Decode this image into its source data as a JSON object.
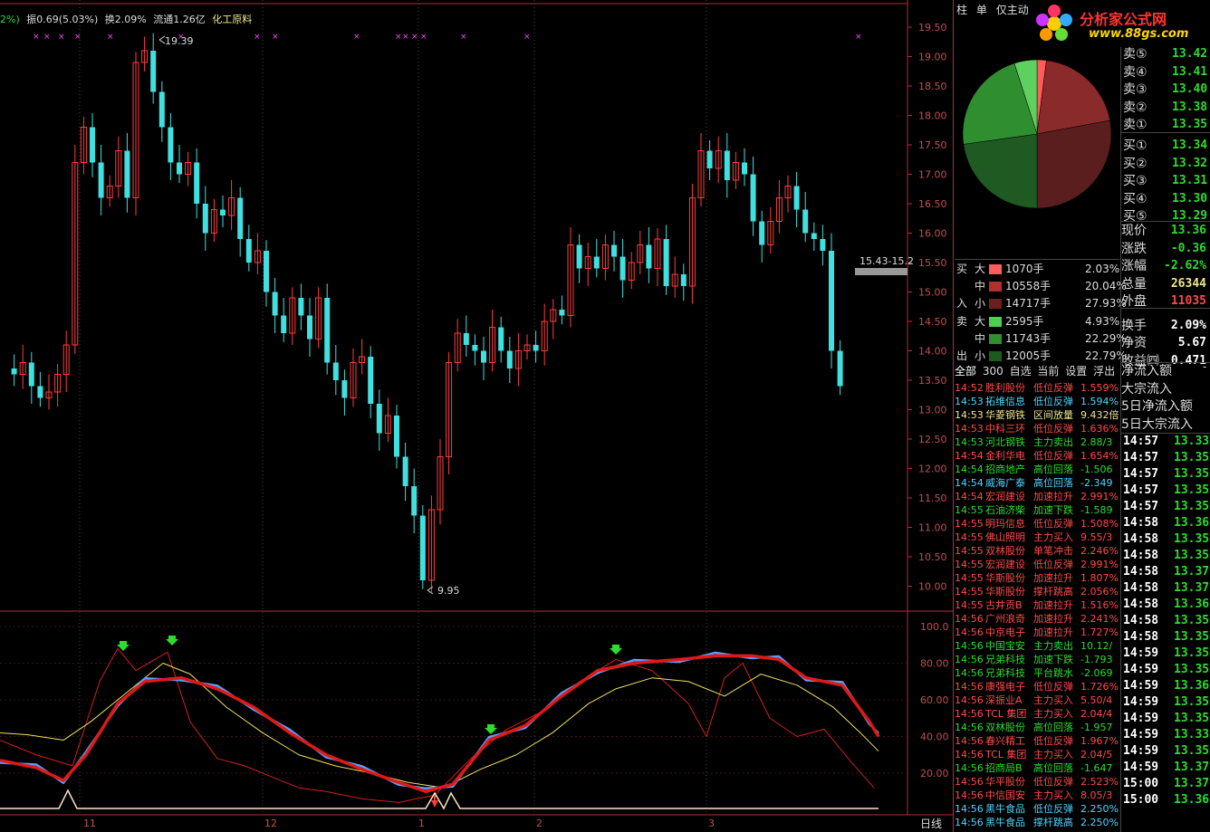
{
  "info_bar": {
    "pct": "2%)",
    "amplitude": "振0.69(5.03%)",
    "turnover": "换2.09%",
    "float": "流通1.26亿",
    "industry": "化工原料"
  },
  "price_axis": [
    "19.50",
    "19.00",
    "18.50",
    "18.00",
    "17.50",
    "17.00",
    "16.50",
    "16.00",
    "15.50",
    "15.00",
    "14.50",
    "14.00",
    "13.50",
    "13.00",
    "12.50",
    "12.00",
    "11.50",
    "11.00",
    "10.50",
    "10.00"
  ],
  "osc_axis": [
    "100.0",
    "80.00",
    "60.00",
    "40.00",
    "20.00"
  ],
  "date_axis": {
    "labels": [
      "11",
      "12",
      "1",
      "2",
      "3"
    ],
    "period": "日线"
  },
  "annotations": {
    "high": "19.39",
    "low": "9.95",
    "range": "15.43-15.2"
  },
  "top_tabs": [
    "柱",
    "单",
    "仅主动"
  ],
  "watermark": {
    "title": "分析家公式网",
    "url": "www.88gs.com"
  },
  "order_book": {
    "asks": [
      {
        "label": "卖⑤",
        "price": "13.42"
      },
      {
        "label": "卖④",
        "price": "13.41"
      },
      {
        "label": "卖③",
        "price": "13.40"
      },
      {
        "label": "卖②",
        "price": "13.38"
      },
      {
        "label": "卖①",
        "price": "13.35"
      }
    ],
    "bids": [
      {
        "label": "买①",
        "price": "13.34"
      },
      {
        "label": "买②",
        "price": "13.32"
      },
      {
        "label": "买③",
        "price": "13.31"
      },
      {
        "label": "买④",
        "price": "13.30"
      },
      {
        "label": "买⑤",
        "price": "13.29"
      }
    ]
  },
  "stats": [
    {
      "label": "现价",
      "value": "13.36",
      "color": "#2ddc2d"
    },
    {
      "label": "涨跌",
      "value": "-0.36",
      "color": "#2ddc2d"
    },
    {
      "label": "涨幅",
      "value": "-2.62%",
      "color": "#2ddc2d"
    },
    {
      "label": "总量",
      "value": "26344",
      "color": "#f0e68c"
    },
    {
      "label": "外盘",
      "value": "11035",
      "color": "#ff4a4a"
    },
    {
      "label": "换手",
      "value": "2.09%",
      "color": "#ffffff"
    },
    {
      "label": "净资",
      "value": "5.67",
      "color": "#ffffff"
    },
    {
      "label": "收益㈣",
      "value": "0.471",
      "color": "#ffffff"
    }
  ],
  "flow_labels": [
    "净流入额",
    "大宗流入",
    "5日净流入额",
    "5日大宗流入"
  ],
  "flow_dash": "-",
  "buy_sell": {
    "buy_side": [
      "买",
      "入"
    ],
    "sell_side": [
      "卖",
      "出"
    ],
    "rows": [
      {
        "group": "大",
        "volume": "1070手",
        "pct": "2.03%",
        "color": "#ff5c5c"
      },
      {
        "group": "中",
        "volume": "10558手",
        "pct": "20.04%",
        "color": "#b03030"
      },
      {
        "group": "小",
        "volume": "14717手",
        "pct": "27.93%",
        "color": "#6b2020"
      },
      {
        "group": "大",
        "volume": "2595手",
        "pct": "4.93%",
        "color": "#4fcf4f"
      },
      {
        "group": "中",
        "volume": "11743手",
        "pct": "22.29%",
        "color": "#2f8f2f"
      },
      {
        "group": "小",
        "volume": "12005手",
        "pct": "22.79%",
        "color": "#1d5a1d"
      }
    ]
  },
  "pie": [
    {
      "value": 2.03,
      "color": "#ff5c5c"
    },
    {
      "value": 20.04,
      "color": "#8b2a2a"
    },
    {
      "value": 27.93,
      "color": "#5a1e1e"
    },
    {
      "value": 22.79,
      "color": "#1f5a22"
    },
    {
      "value": 22.29,
      "color": "#2f8f2f"
    },
    {
      "value": 4.93,
      "color": "#5fcf5f"
    }
  ],
  "alert_tabs": [
    "全部",
    "300",
    "自选",
    "当前",
    "设置",
    "浮出"
  ],
  "alerts": [
    {
      "time": "14:52",
      "name": "胜利股份",
      "signal": "低位反弹",
      "chg": "1.559%",
      "color": "#ff4a4a"
    },
    {
      "time": "14:53",
      "name": "拓维信息",
      "signal": "低位反弹",
      "chg": "1.594%",
      "color": "#4fd5ff"
    },
    {
      "time": "14:53",
      "name": "华菱钢铁",
      "signal": "区间放量",
      "chg": "9.432倍",
      "color": "#f0e68c"
    },
    {
      "time": "14:53",
      "name": "中科三环",
      "signal": "低位反弹",
      "chg": "1.636%",
      "color": "#ff4a4a"
    },
    {
      "time": "14:53",
      "name": "河北钢铁",
      "signal": "主力卖出",
      "chg": "2.88/3",
      "color": "#2ddc2d"
    },
    {
      "time": "14:54",
      "name": "金利华电",
      "signal": "低位反弹",
      "chg": "1.654%",
      "color": "#ff4a4a"
    },
    {
      "time": "14:54",
      "name": "招商地产",
      "signal": "高位回落",
      "chg": "-1.506",
      "color": "#2ddc2d"
    },
    {
      "time": "14:54",
      "name": "威海广泰",
      "signal": "高位回落",
      "chg": "-2.349",
      "color": "#4fd5ff"
    },
    {
      "time": "14:54",
      "name": "宏润建设",
      "signal": "加速拉升",
      "chg": "2.991%",
      "color": "#ff4a4a"
    },
    {
      "time": "14:55",
      "name": "石油济柴",
      "signal": "加速下跌",
      "chg": "-1.589",
      "color": "#2ddc2d"
    },
    {
      "time": "14:55",
      "name": "明玛信息",
      "signal": "低位反弹",
      "chg": "1.508%",
      "color": "#ff4a4a"
    },
    {
      "time": "14:55",
      "name": "佛山照明",
      "signal": "主力买入",
      "chg": "9.55/3",
      "color": "#ff4a4a"
    },
    {
      "time": "14:55",
      "name": "双林股份",
      "signal": "单笔冲击",
      "chg": "2.246%",
      "color": "#ff4a4a"
    },
    {
      "time": "14:55",
      "name": "宏润建设",
      "signal": "低位反弹",
      "chg": "2.991%",
      "color": "#ff4a4a"
    },
    {
      "time": "14:55",
      "name": "华斯股份",
      "signal": "加速拉升",
      "chg": "1.807%",
      "color": "#ff4a4a"
    },
    {
      "time": "14:55",
      "name": "华斯股份",
      "signal": "撑杆跳高",
      "chg": "2.056%",
      "color": "#ff4a4a"
    },
    {
      "time": "14:55",
      "name": "古井贡B",
      "signal": "加速拉升",
      "chg": "1.516%",
      "color": "#ff4a4a"
    },
    {
      "time": "14:56",
      "name": "广州浪奇",
      "signal": "加速拉升",
      "chg": "2.241%",
      "color": "#ff4a4a"
    },
    {
      "time": "14:56",
      "name": "中京电子",
      "signal": "加速拉升",
      "chg": "1.727%",
      "color": "#ff4a4a"
    },
    {
      "time": "14:56",
      "name": "中国宝安",
      "signal": "主力卖出",
      "chg": "10.12/",
      "color": "#2ddc2d"
    },
    {
      "time": "14:56",
      "name": "兄弟科技",
      "signal": "加速下跌",
      "chg": "-1.793",
      "color": "#2ddc2d"
    },
    {
      "time": "14:56",
      "name": "兄弟科技",
      "signal": "平台跳水",
      "chg": "-2.069",
      "color": "#2ddc2d"
    },
    {
      "time": "14:56",
      "name": "康强电子",
      "signal": "低位反弹",
      "chg": "1.726%",
      "color": "#ff4a4a"
    },
    {
      "time": "14:56",
      "name": "深振业A",
      "signal": "主力买入",
      "chg": "5.50/4",
      "color": "#ff4a4a"
    },
    {
      "time": "14:56",
      "name": "TCL 集团",
      "signal": "主力买入",
      "chg": "2.04/4",
      "color": "#ff4a4a"
    },
    {
      "time": "14:56",
      "name": "双林股份",
      "signal": "高位回落",
      "chg": "-1.957",
      "color": "#2ddc2d"
    },
    {
      "time": "14:56",
      "name": "春兴精工",
      "signal": "低位反弹",
      "chg": "1.967%",
      "color": "#ff4a4a"
    },
    {
      "time": "14:56",
      "name": "TCL 集团",
      "signal": "主力买入",
      "chg": "2.04/5",
      "color": "#ff4a4a"
    },
    {
      "time": "14:56",
      "name": "招商局B",
      "signal": "高位回落",
      "chg": "-1.647",
      "color": "#2ddc2d"
    },
    {
      "time": "14:56",
      "name": "华平股份",
      "signal": "低位反弹",
      "chg": "2.523%",
      "color": "#ff4a4a"
    },
    {
      "time": "14:56",
      "name": "中信国安",
      "signal": "主力买入",
      "chg": "8.05/3",
      "color": "#ff4a4a"
    },
    {
      "time": "14:56",
      "name": "黑牛食品",
      "signal": "低位反弹",
      "chg": "2.250%",
      "color": "#4fd5ff"
    },
    {
      "time": "14:56",
      "name": "黑牛食品",
      "signal": "撑杆跳高",
      "chg": "2.250%",
      "color": "#4fd5ff"
    }
  ],
  "ticks": [
    {
      "time": "14:57",
      "price": "13.33"
    },
    {
      "time": "14:57",
      "price": "13.35"
    },
    {
      "time": "14:57",
      "price": "13.35"
    },
    {
      "time": "14:57",
      "price": "13.35"
    },
    {
      "time": "14:57",
      "price": "13.35"
    },
    {
      "time": "14:58",
      "price": "13.36"
    },
    {
      "time": "14:58",
      "price": "13.35"
    },
    {
      "time": "14:58",
      "price": "13.35"
    },
    {
      "time": "14:58",
      "price": "13.37"
    },
    {
      "time": "14:58",
      "price": "13.37"
    },
    {
      "time": "14:58",
      "price": "13.36"
    },
    {
      "time": "14:58",
      "price": "13.35"
    },
    {
      "time": "14:58",
      "price": "13.35"
    },
    {
      "time": "14:59",
      "price": "13.35"
    },
    {
      "time": "14:59",
      "price": "13.35"
    },
    {
      "time": "14:59",
      "price": "13.36"
    },
    {
      "time": "14:59",
      "price": "13.35"
    },
    {
      "time": "14:59",
      "price": "13.35"
    },
    {
      "time": "14:59",
      "price": "13.33"
    },
    {
      "time": "14:59",
      "price": "13.35"
    },
    {
      "time": "14:59",
      "price": "13.37"
    },
    {
      "time": "15:00",
      "price": "13.37"
    },
    {
      "time": "15:00",
      "price": "13.36"
    }
  ],
  "chart_data": {
    "type": "candlestick",
    "price_axis_range": [
      10.0,
      19.5
    ],
    "high": 19.39,
    "low": 9.95,
    "oscillator_range": [
      0,
      100
    ],
    "oscillator_ticks": [
      100,
      80,
      60,
      40,
      20
    ],
    "x_labels": [
      "11",
      "12",
      "1",
      "2",
      "3"
    ]
  }
}
